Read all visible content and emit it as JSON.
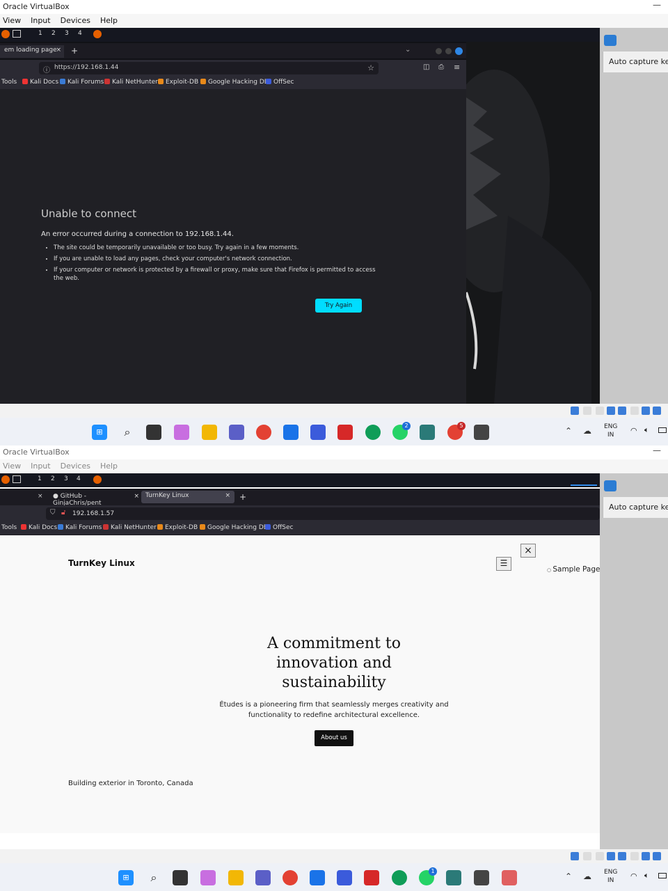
{
  "top": {
    "window_title": "Oracle VirtualBox",
    "menu": [
      "View",
      "Input",
      "Devices",
      "Help"
    ],
    "workspaces": [
      "1",
      "2",
      "3",
      "4"
    ],
    "tab_label": "em loading page",
    "tab_close": "×",
    "tab_new": "+",
    "url": "https://192.168.1.44",
    "bookmarks": [
      "Tools",
      "Kali Docs",
      "Kali Forums",
      "Kali NetHunter",
      "Exploit-DB",
      "Google Hacking DB",
      "OffSec"
    ],
    "error": {
      "title": "Unable to connect",
      "message": "An error occurred during a connection to 192.168.1.44.",
      "bullets": [
        "The site could be temporarily unavailable or too busy. Try again in a few moments.",
        "If you are unable to load any pages, check your computer's network connection.",
        "If your computer or network is protected by a firewall or proxy, make sure that Firefox is permitted to access the web."
      ],
      "button": "Try Again"
    },
    "side_label": "Auto capture keyb",
    "tray": {
      "lang": "ENG",
      "region": "IN"
    },
    "whatsapp_badge": "2",
    "chrome_badge": "5"
  },
  "bottom": {
    "window_title": "Oracle VirtualBox",
    "menu": [
      "View",
      "Input",
      "Devices",
      "Help"
    ],
    "workspaces": [
      "1",
      "2",
      "3",
      "4"
    ],
    "tabs": [
      {
        "label": "GitHub - GinjaChris/pent"
      },
      {
        "label": "TurnKey Linux"
      }
    ],
    "tab_close": "×",
    "tab_new": "+",
    "url": "192.168.1.57",
    "bookmarks": [
      "Tools",
      "Kali Docs",
      "Kali Forums",
      "Kali NetHunter",
      "Exploit-DB",
      "Google Hacking DB",
      "OffSec"
    ],
    "site": {
      "brand": "TurnKey Linux",
      "close": "×",
      "menu_item": "Sample Page",
      "hero_title": "A commitment to innovation and sustainability",
      "hero_text": "Études is a pioneering firm that seamlessly merges creativity and functionality to redefine architectural excellence.",
      "button": "About us",
      "caption": "Building exterior in Toronto, Canada"
    },
    "side_label": "Auto capture keyb",
    "tray": {
      "lang": "ENG",
      "region": "IN"
    },
    "whatsapp_badge": "1"
  },
  "colors": {
    "kali_panel": "#151720",
    "firefox_dark": "#1c1b22",
    "error_bg": "#202025",
    "try_again": "#00ddff",
    "site_bg": "#f9f9f9"
  }
}
